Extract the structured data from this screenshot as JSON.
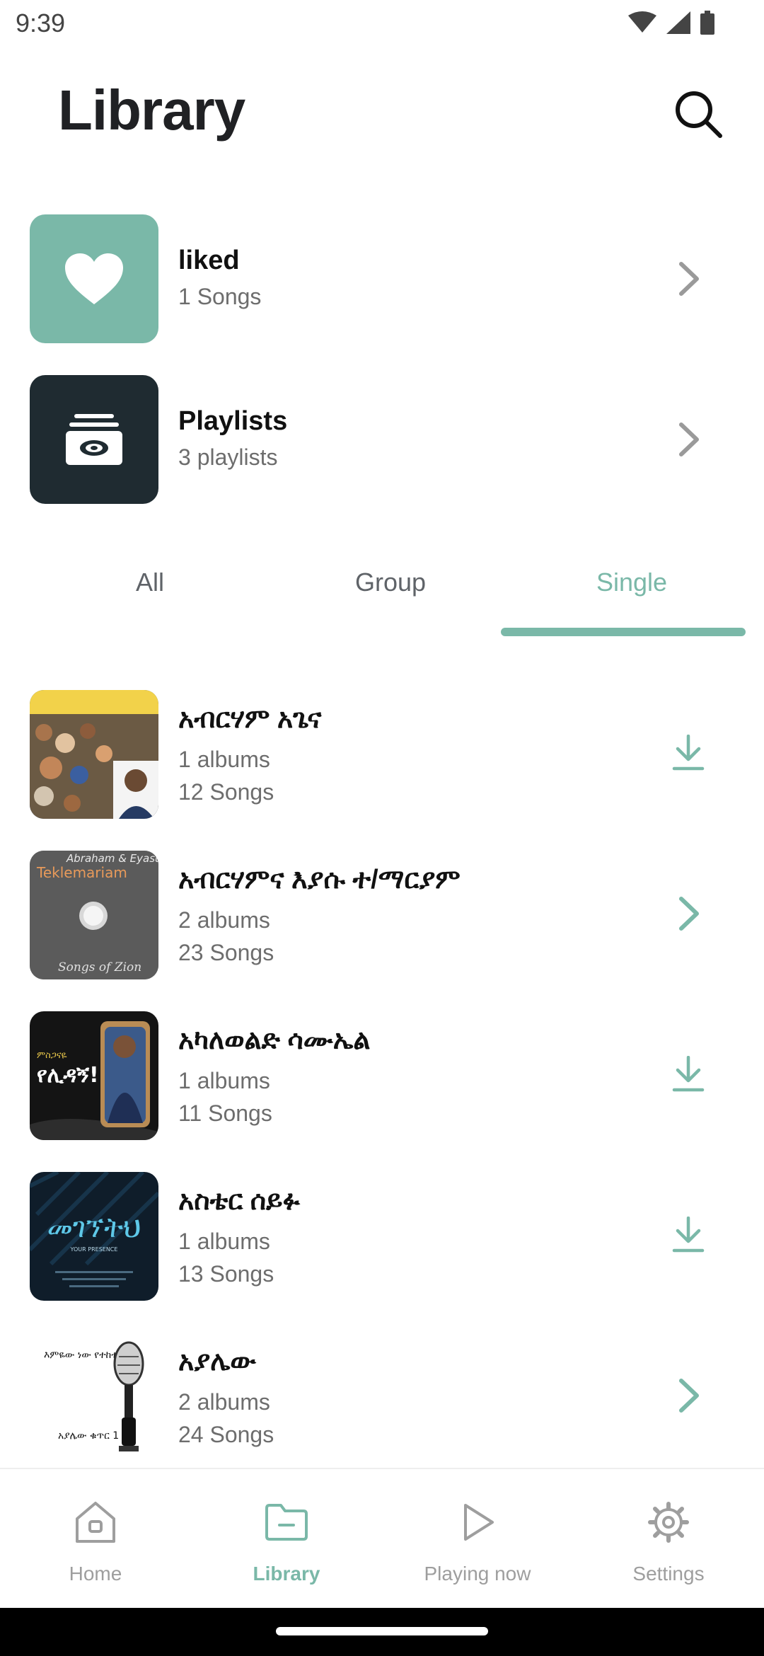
{
  "status_bar": {
    "time": "9:39"
  },
  "header": {
    "title": "Library"
  },
  "collections": [
    {
      "title": "liked",
      "subtitle": "1 Songs",
      "icon": "heart-icon",
      "color": "#7ab8a8"
    },
    {
      "title": "Playlists",
      "subtitle": "3 playlists",
      "icon": "playlist-box-icon",
      "color": "#1f2b31"
    }
  ],
  "tabs": [
    {
      "label": "All",
      "active": false
    },
    {
      "label": "Group",
      "active": false
    },
    {
      "label": "Single",
      "active": true
    }
  ],
  "artists": [
    {
      "name": "አብርሃም አጌና",
      "albums": "1 albums",
      "songs": "12 Songs",
      "action": "download-icon"
    },
    {
      "name": "አብርሃምና እያሱ ተ/ማርያም",
      "albums": "2 albums",
      "songs": "23 Songs",
      "action": "chevron-right-icon",
      "cover_text": "Abraham & Eyasu",
      "cover_title": "Teklemariam",
      "cover_sub": "Songs of Zion"
    },
    {
      "name": " አካለወልድ ሳሙኤል",
      "albums": "1 albums",
      "songs": "11 Songs",
      "action": "download-icon",
      "cover_text": "ምስጋናዬ",
      "cover_title": "የሊዳኝ!"
    },
    {
      "name": "አስቴር ሰይፉ",
      "albums": "1 albums",
      "songs": "13 Songs",
      "action": "download-icon",
      "cover_title": "መገኘትህ",
      "cover_sub": "YOUR PRESENCE"
    },
    {
      "name": "አያሌው",
      "albums": "2 albums",
      "songs": "24 Songs",
      "action": "chevron-right-icon",
      "cover_text": "እምዬው ነው የተከተልኩት",
      "cover_sub": "አያሌው ቁጥር 1"
    }
  ],
  "bottom_nav": [
    {
      "label": "Home",
      "icon": "home-icon",
      "active": false
    },
    {
      "label": "Library",
      "icon": "folder-icon",
      "active": true
    },
    {
      "label": "Playing now",
      "icon": "play-icon",
      "active": false
    },
    {
      "label": "Settings",
      "icon": "gear-icon",
      "active": false
    }
  ],
  "colors": {
    "accent": "#7ab8a8",
    "dark_tile": "#1f2b31",
    "text_secondary": "#6d6d6d",
    "nav_inactive": "#9e9e9e"
  }
}
